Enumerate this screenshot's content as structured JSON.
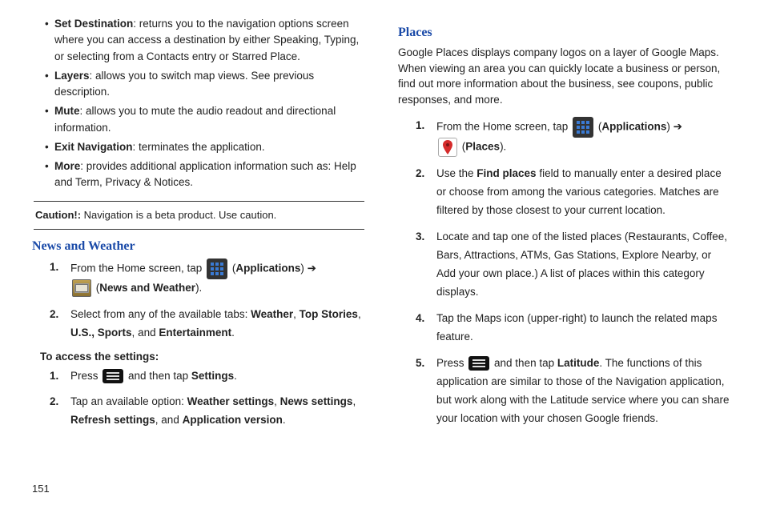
{
  "left": {
    "bullets": [
      {
        "term": "Set Destination",
        "desc": ": returns you to the navigation options screen where you can access a destination by either Speaking, Typing, or selecting from a Contacts entry or Starred Place."
      },
      {
        "term": "Layers",
        "desc": ": allows you to switch map views. See previous description."
      },
      {
        "term": "Mute",
        "desc": ": allows you to mute the audio readout and directional information."
      },
      {
        "term": "Exit Navigation",
        "desc": ": terminates the application."
      },
      {
        "term": "More",
        "desc": ": provides additional application information such as: Help and Term, Privacy & Notices."
      }
    ],
    "caution_label": "Caution!:",
    "caution_text": " Navigation is a beta product. Use caution.",
    "section": "News and Weather",
    "step1_a": "From the Home screen, tap ",
    "applications": "Applications",
    "arrow": " ➔",
    "news_weather": "News and Weather",
    "step2_a": "Select from any of the available tabs: ",
    "step2_tabs": [
      "Weather",
      "Top Stories",
      "U.S.,",
      "Sports",
      "Entertainment"
    ],
    "and": " and ",
    "comma": ", ",
    "period": ".",
    "subhead": "To access the settings:",
    "set1_a": "Press ",
    "set1_b": " and then tap ",
    "settings": "Settings",
    "set2_a": "Tap an available option: ",
    "set2_opts": [
      "Weather settings",
      "News settings",
      "Refresh settings",
      "Application version"
    ]
  },
  "right": {
    "section": "Places",
    "intro": "Google Places displays company logos on a layer of Google Maps. When viewing an area you can quickly locate a business or person, find out more information about the business, see coupons, public responses, and more.",
    "step1_a": "From the Home screen, tap ",
    "applications": "Applications",
    "arrow": " ➔",
    "places": "Places",
    "step2_a": "Use the ",
    "find_places": "Find places",
    "step2_b": " field to manually enter a desired place or choose from among the various categories. Matches are filtered by those closest to your current location.",
    "step3": "Locate and tap one of the listed places (Restaurants, Coffee, Bars, Attractions, ATMs, Gas Stations, Explore Nearby, or Add your own place.) A list of places within this category displays.",
    "step4": "Tap the Maps icon (upper-right) to launch the related maps feature.",
    "step5_a": "Press ",
    "step5_b": " and then tap ",
    "latitude": "Latitude",
    "step5_c": ". The functions of this application are similar to those of the Navigation application, but work along with the Latitude service where you can share your location with your chosen Google friends."
  },
  "page_number": "151"
}
